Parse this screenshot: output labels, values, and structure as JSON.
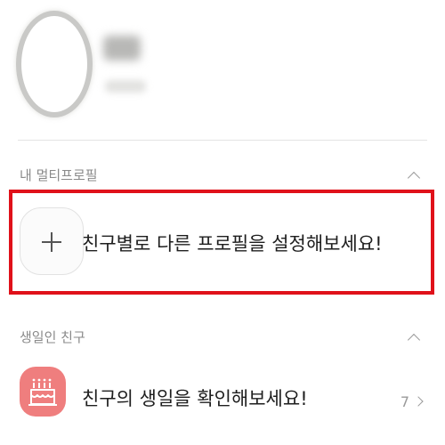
{
  "profile": {
    "avatar_icon": "avatar-placeholder"
  },
  "multi_profile": {
    "section_title": "내 멀티프로필",
    "add_prompt": "친구별로 다른 프로필을 설정해보세요!",
    "add_icon": "plus-icon"
  },
  "birthday": {
    "section_title": "생일인 친구",
    "prompt": "친구의 생일을 확인해보세요!",
    "count": "7",
    "icon": "cake-icon"
  },
  "colors": {
    "highlight": "#e0111a",
    "birthday_tile": "#ef7e7e",
    "divider": "#e4e4e4"
  }
}
